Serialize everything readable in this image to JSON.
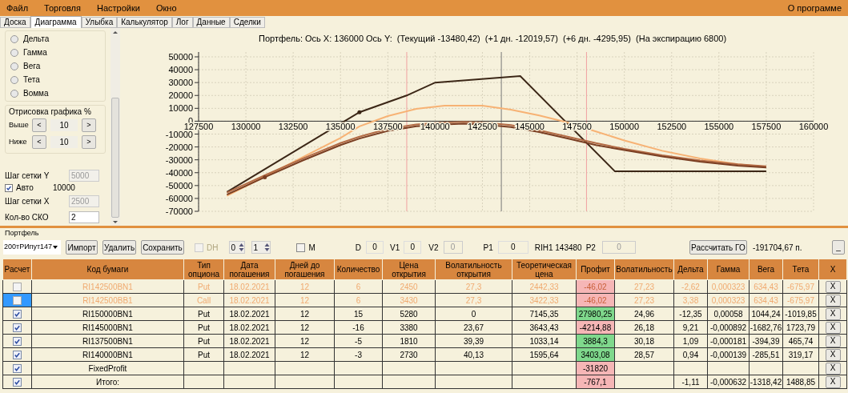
{
  "menu": [
    {
      "label": "Файл"
    },
    {
      "label": "Торговля"
    },
    {
      "label": "Настройки"
    },
    {
      "label": "Окно"
    }
  ],
  "menu_right": "О программе",
  "tabs": [
    {
      "label": "Доска",
      "selected": false
    },
    {
      "label": "Диаграмма",
      "selected": true
    },
    {
      "label": "Улыбка",
      "selected": false
    },
    {
      "label": "Калькулятор",
      "selected": false
    },
    {
      "label": "Лог",
      "selected": false
    },
    {
      "label": "Данные",
      "selected": false
    },
    {
      "label": "Сделки",
      "selected": false
    }
  ],
  "greeks": [
    {
      "label": "Дельта",
      "selected": false
    },
    {
      "label": "Гамма",
      "selected": false
    },
    {
      "label": "Вега",
      "selected": false
    },
    {
      "label": "Тета",
      "selected": false
    },
    {
      "label": "Вомма",
      "selected": false
    }
  ],
  "draw_group": {
    "title": "Отрисовка графика %",
    "rows": [
      {
        "label": "Выше",
        "dec": "<",
        "value": "10",
        "inc": ">"
      },
      {
        "label": "Ниже",
        "dec": "<",
        "value": "10",
        "inc": ">"
      }
    ]
  },
  "grid_settings": {
    "y_label": "Шаг сетки Y",
    "y_value": "5000",
    "auto": {
      "label": "Авто",
      "checked": true,
      "value": "10000"
    },
    "x_label": "Шаг сетки X",
    "x_value": "2500",
    "sko_label": "Кол-во СКО",
    "sko_value": "2"
  },
  "chart": {
    "title": "Портфель: Ось X: 136000 Ось Y:  (Текущий -13480,42)  (+1 дн. -12019,57)  (+6 дн. -4295,95)  (На экспирацию 6800)",
    "chart_data": {
      "type": "line",
      "grid": true,
      "xlim": [
        127500,
        160000
      ],
      "ylim": [
        -70000,
        50000
      ],
      "xticks": [
        127500,
        130000,
        132500,
        135000,
        137500,
        140000,
        142500,
        145000,
        147500,
        150000,
        152500,
        155000,
        157500,
        160000
      ],
      "yticks": [
        -70000,
        -60000,
        -50000,
        -40000,
        -30000,
        -20000,
        -10000,
        0,
        10000,
        20000,
        30000,
        40000,
        50000
      ],
      "series": [
        {
          "color": "#3b2616",
          "marker": true,
          "x": [
            129000,
            136000,
            138500,
            140000,
            144500,
            149500,
            157500
          ],
          "values": [
            -55000,
            7000,
            20000,
            30000,
            35000,
            -39000,
            -39000
          ]
        },
        {
          "color": "#f7b274",
          "marker": false,
          "x": [
            129000,
            131000,
            133000,
            135000,
            136000,
            137500,
            139000,
            140500,
            141500,
            142500,
            144000,
            145500,
            147000,
            148500,
            150000,
            152000,
            154000,
            156000,
            157500
          ],
          "values": [
            -58000,
            -43000,
            -28000,
            -13000,
            -4000,
            4000,
            9500,
            12000,
            12000,
            12000,
            9000,
            4500,
            -1000,
            -8000,
            -15000,
            -23000,
            -29000,
            -33500,
            -35500
          ]
        },
        {
          "color": "#b36b45",
          "marker": false,
          "x": [
            129000,
            131000,
            133000,
            135000,
            136000,
            137500,
            139000,
            140500,
            141500,
            142500,
            144000,
            145500,
            147000,
            148500,
            150000,
            152000,
            154000,
            156000,
            157500
          ],
          "values": [
            -55500,
            -42000,
            -29000,
            -17000,
            -12000,
            -6000,
            -2500,
            -1000,
            -500,
            -1000,
            -3000,
            -7000,
            -12000,
            -17000,
            -21500,
            -26500,
            -30500,
            -33500,
            -35000
          ]
        },
        {
          "color": "#7a3e22",
          "marker": true,
          "x": [
            129000,
            131000,
            133000,
            135000,
            136000,
            137500,
            139000,
            140500,
            141500,
            142500,
            144000,
            145500,
            147000,
            148500,
            150000,
            152000,
            154000,
            156000,
            157500
          ],
          "values": [
            -57000,
            -43500,
            -30500,
            -18500,
            -13500,
            -7500,
            -4000,
            -2500,
            -2000,
            -2500,
            -4500,
            -8500,
            -13500,
            -18500,
            -22500,
            -27500,
            -31500,
            -34500,
            -36000
          ]
        }
      ],
      "ref_lines": [
        {
          "axis": "x",
          "value": 138500,
          "color": "#f0a0a0"
        },
        {
          "axis": "x",
          "value": 143500,
          "color": "#777777"
        },
        {
          "axis": "x",
          "value": 148000,
          "color": "#f0a0a0"
        }
      ]
    }
  },
  "portfolio": {
    "title": "Портфель",
    "combo": "200тРИпут147",
    "buttons": [
      {
        "label": "Импорт"
      },
      {
        "label": "Удалить"
      },
      {
        "label": "Сохранить"
      }
    ],
    "dh": {
      "label": "DH",
      "checked": false,
      "disabled": true
    },
    "spinners": [
      "0",
      "1"
    ],
    "m": {
      "label": "M",
      "checked": false
    },
    "fields": [
      {
        "label": "D",
        "value": "0",
        "disabled": false
      },
      {
        "label": "V1",
        "value": "0",
        "disabled": false
      },
      {
        "label": "V2",
        "value": "0",
        "disabled": true
      },
      {
        "label": "P1",
        "value": "0",
        "disabled": false
      }
    ],
    "underlying": "RIH1 143480",
    "p2": {
      "label": "P2",
      "value": "0",
      "disabled": true
    },
    "calc_button": "Рассчитать ГО",
    "margin": "-191704,67 п.",
    "minimize": "_"
  },
  "table": {
    "columns": [
      "Расчет",
      "Код бумаги",
      "Тип опциона",
      "Дата погашения",
      "Дней до погашения",
      "Количество",
      "Цена открытия",
      "Волатильность открытия",
      "Теоретическая цена",
      "Профит",
      "Волатильность",
      "Дельта",
      "Гамма",
      "Вега",
      "Тета",
      "X"
    ],
    "rows": [
      {
        "checked": false,
        "faded": true,
        "selected": false,
        "color": "#f6b6b6",
        "cells": [
          "",
          "RI142500BN1",
          "Put",
          "18.02.2021",
          "12",
          "6",
          "2450",
          "27,3",
          "2442,33",
          "-46,02",
          "27,23",
          "-2,62",
          "0,000323",
          "634,43",
          "-675,97",
          "X"
        ]
      },
      {
        "checked": false,
        "faded": true,
        "selected": true,
        "color": "#f6b6b6",
        "cells": [
          "",
          "RI142500BB1",
          "Call",
          "18.02.2021",
          "12",
          "6",
          "3430",
          "27,3",
          "3422,33",
          "-46,02",
          "27,23",
          "3,38",
          "0,000323",
          "634,43",
          "-675,97",
          "X"
        ]
      },
      {
        "checked": true,
        "faded": false,
        "selected": false,
        "color": "#7fd88c",
        "cells": [
          "",
          "RI150000BN1",
          "Put",
          "18.02.2021",
          "12",
          "15",
          "5280",
          "0",
          "7145,35",
          "27980,25",
          "24,96",
          "-12,35",
          "0,00058",
          "1044,24",
          "-1019,85",
          "X"
        ]
      },
      {
        "checked": true,
        "faded": false,
        "selected": false,
        "color": "#f6b6b6",
        "cells": [
          "",
          "RI145000BN1",
          "Put",
          "18.02.2021",
          "12",
          "-16",
          "3380",
          "23,67",
          "3643,43",
          "-4214,88",
          "26,18",
          "9,21",
          "-0,000892",
          "-1682,76",
          "1723,79",
          "X"
        ]
      },
      {
        "checked": true,
        "faded": false,
        "selected": false,
        "color": "#7fd88c",
        "cells": [
          "",
          "RI137500BN1",
          "Put",
          "18.02.2021",
          "12",
          "-5",
          "1810",
          "39,39",
          "1033,14",
          "3884,3",
          "30,18",
          "1,09",
          "-0,000181",
          "-394,39",
          "465,74",
          "X"
        ]
      },
      {
        "checked": true,
        "faded": false,
        "selected": false,
        "color": "#7fd88c",
        "cells": [
          "",
          "RI140000BN1",
          "Put",
          "18.02.2021",
          "12",
          "-3",
          "2730",
          "40,13",
          "1595,64",
          "3403,08",
          "28,57",
          "0,94",
          "-0,000139",
          "-285,51",
          "319,17",
          "X"
        ]
      },
      {
        "checked": true,
        "faded": false,
        "selected": false,
        "color": "#f6b6b6",
        "cells": [
          "",
          "FixedProfit",
          "",
          "",
          "",
          "",
          "",
          "",
          "",
          "-31820",
          "",
          "",
          "",
          "",
          "",
          "X"
        ]
      },
      {
        "checked": true,
        "faded": false,
        "selected": false,
        "color": "#f6b6b6",
        "cells": [
          "",
          "Итого:",
          "",
          "",
          "",
          "",
          "",
          "",
          "",
          "-767,1",
          "",
          "-1,11",
          "-0,000632",
          "-1318,42",
          "1488,85",
          "X"
        ]
      }
    ]
  }
}
